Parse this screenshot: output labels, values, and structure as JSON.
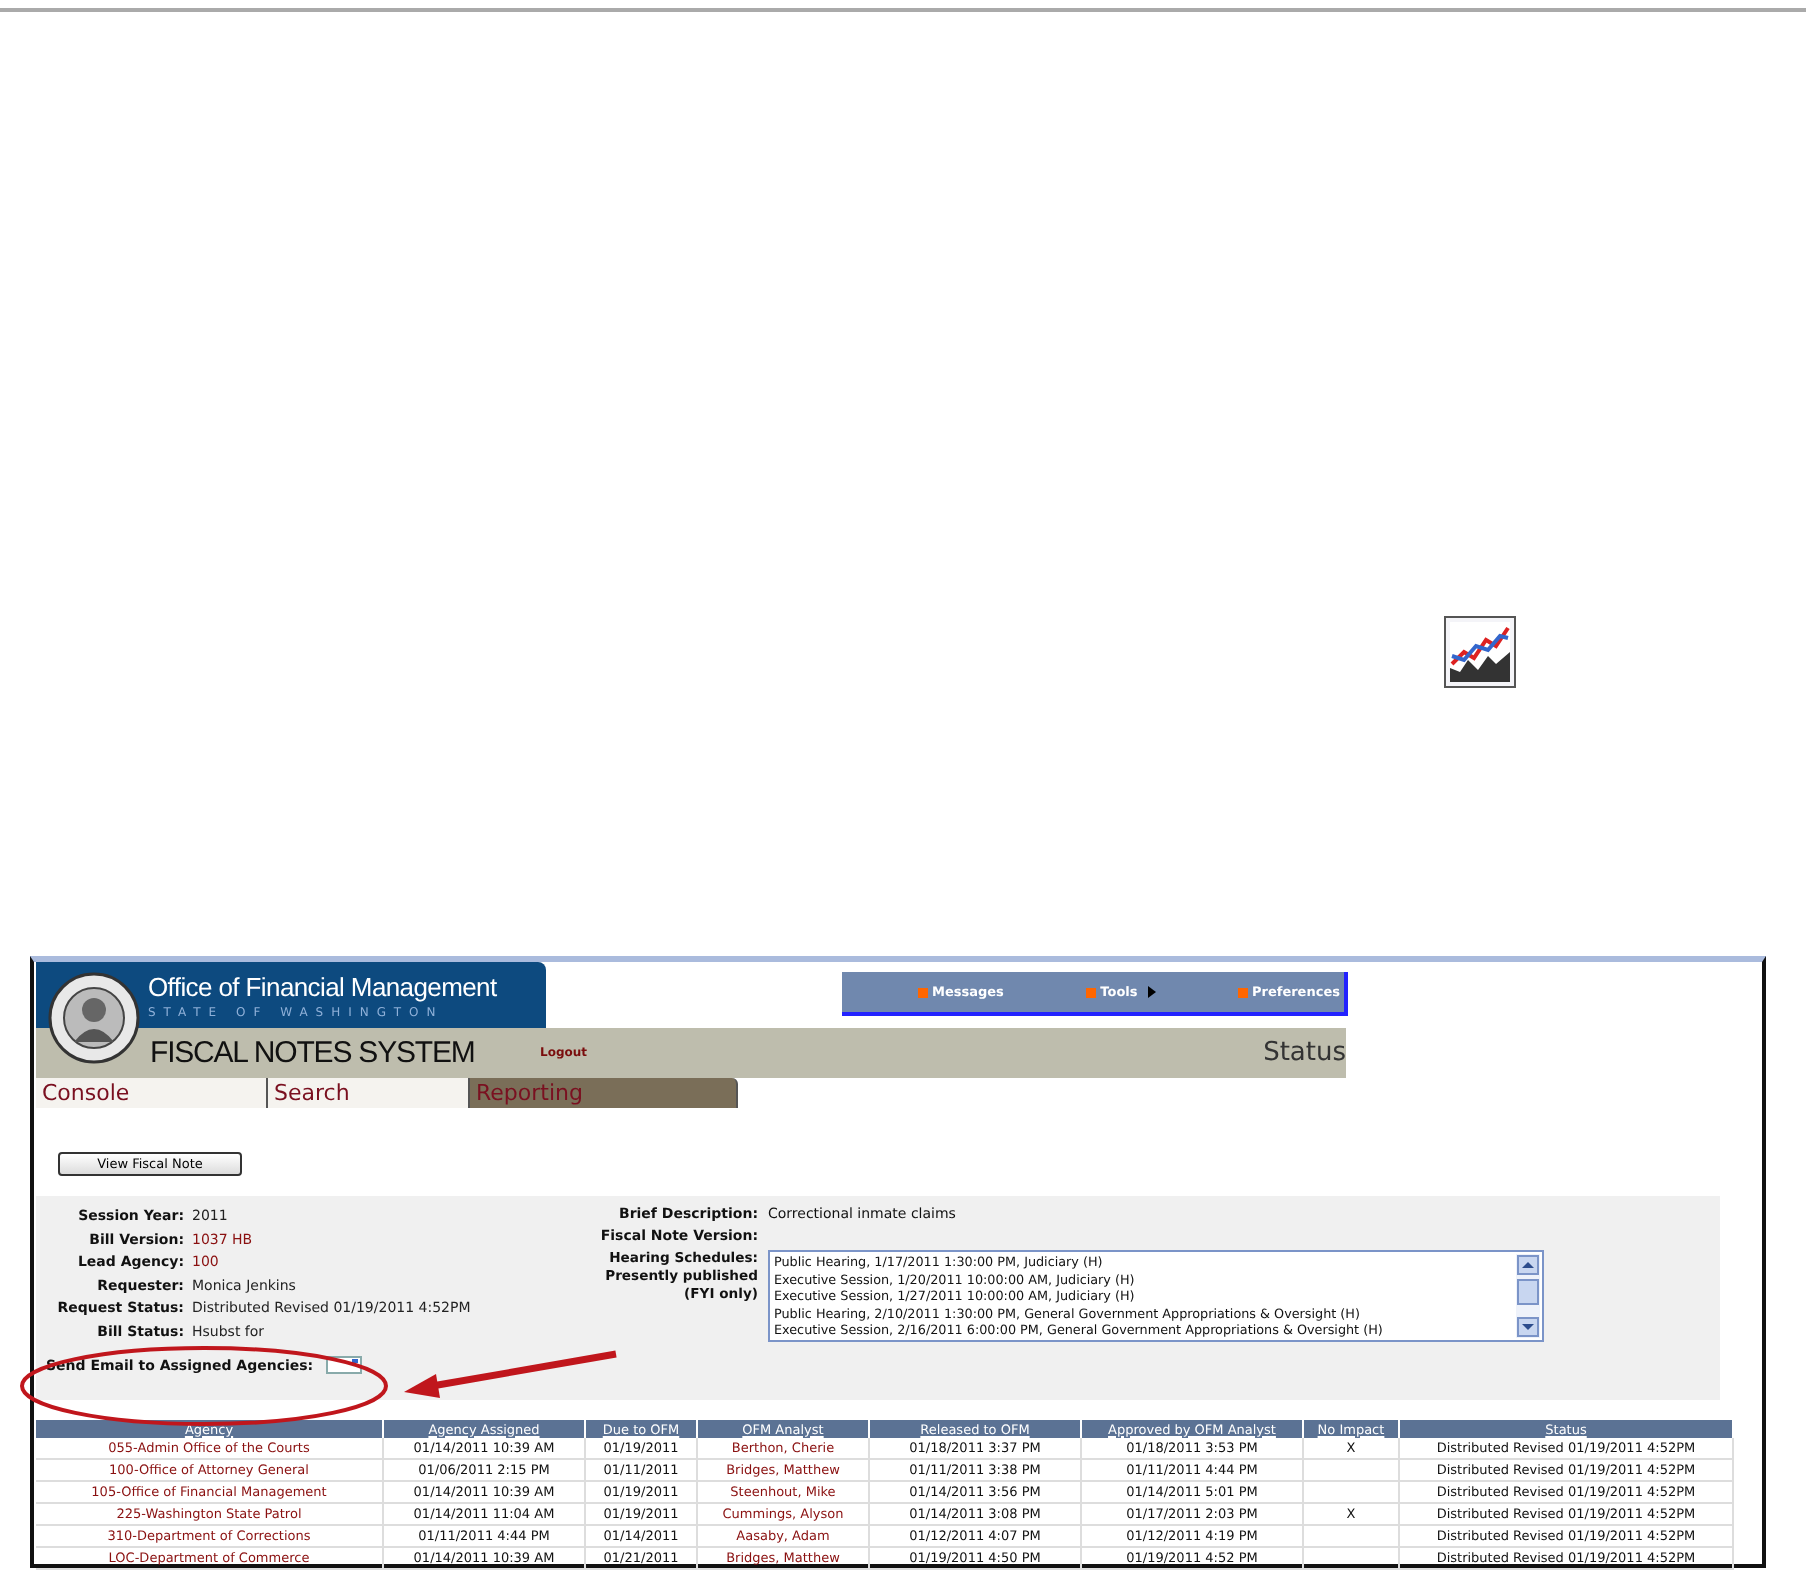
{
  "header": {
    "title": "Office of Financial Management",
    "subtitle": "STATE OF WASHINGTON",
    "system_name": "FISCAL NOTES SYSTEM",
    "logout": "Logout",
    "page_title": "Status"
  },
  "nav": [
    {
      "label": "Messages",
      "submenu": false
    },
    {
      "label": "Tools",
      "submenu": true
    },
    {
      "label": "Preferences",
      "submenu": false
    }
  ],
  "tabs": [
    {
      "label": "Console",
      "selected": false
    },
    {
      "label": "Search",
      "selected": false
    },
    {
      "label": "Reporting",
      "selected": true
    }
  ],
  "view_button": "View Fiscal Note",
  "details_left": [
    {
      "label": "Session Year:",
      "value": "2011",
      "link": false
    },
    {
      "label": "Bill Version:",
      "value": "1037 HB",
      "link": true
    },
    {
      "label": "Lead Agency:",
      "value": "100",
      "link": true
    },
    {
      "label": "Requester:",
      "value": "Monica Jenkins",
      "link": false
    },
    {
      "label": "Request Status:",
      "value": "Distributed Revised 01/19/2011 4:52PM",
      "link": false
    },
    {
      "label": "Bill Status:",
      "value": "Hsubst for",
      "link": false
    }
  ],
  "details_right": {
    "brief_label": "Brief Description:",
    "brief_value": "Correctional inmate claims",
    "version_label": "Fiscal Note Version:",
    "hearing_label": "Hearing Schedules:",
    "hearing_note": "Presently published",
    "hearing_note2": "(FYI only)",
    "hearings": [
      "Public Hearing, 1/17/2011 1:30:00 PM, Judiciary (H)",
      "Executive Session, 1/20/2011 10:00:00 AM, Judiciary (H)",
      "Executive Session, 1/27/2011 10:00:00 AM, Judiciary (H)",
      "Public Hearing, 2/10/2011 1:30:00 PM, General Government Appropriations & Oversight (H)",
      "Executive Session, 2/16/2011 6:00:00 PM, General Government Appropriations & Oversight (H)"
    ]
  },
  "email_label": "Send Email to Assigned Agencies:",
  "table": {
    "columns": [
      "Agency",
      "Agency Assigned",
      "Due to OFM",
      "OFM Analyst",
      "Released to OFM",
      "Approved by OFM Analyst",
      "No Impact",
      "Status"
    ],
    "rows": [
      [
        "055-Admin Office of the Courts",
        "01/14/2011 10:39 AM",
        "01/19/2011",
        "Berthon, Cherie",
        "01/18/2011 3:37 PM",
        "01/18/2011 3:53 PM",
        "X",
        "Distributed Revised 01/19/2011 4:52PM"
      ],
      [
        "100-Office of Attorney General",
        "01/06/2011 2:15 PM",
        "01/11/2011",
        "Bridges, Matthew",
        "01/11/2011 3:38 PM",
        "01/11/2011 4:44 PM",
        "",
        "Distributed Revised 01/19/2011 4:52PM"
      ],
      [
        "105-Office of Financial Management",
        "01/14/2011 10:39 AM",
        "01/19/2011",
        "Steenhout, Mike",
        "01/14/2011 3:56 PM",
        "01/14/2011 5:01 PM",
        "",
        "Distributed Revised 01/19/2011 4:52PM"
      ],
      [
        "225-Washington State Patrol",
        "01/14/2011 11:04 AM",
        "01/19/2011",
        "Cummings, Alyson",
        "01/14/2011 3:08 PM",
        "01/17/2011 2:03 PM",
        "X",
        "Distributed Revised 01/19/2011 4:52PM"
      ],
      [
        "310-Department of Corrections",
        "01/11/2011 4:44 PM",
        "01/14/2011",
        "Aasaby, Adam",
        "01/12/2011 4:07 PM",
        "01/12/2011 4:19 PM",
        "",
        "Distributed Revised 01/19/2011 4:52PM"
      ],
      [
        "LOC-Department of Commerce",
        "01/14/2011 10:39 AM",
        "01/21/2011",
        "Bridges, Matthew",
        "01/19/2011 4:50 PM",
        "01/19/2011 4:52 PM",
        "",
        "Distributed Revised 01/19/2011 4:52PM"
      ]
    ]
  }
}
